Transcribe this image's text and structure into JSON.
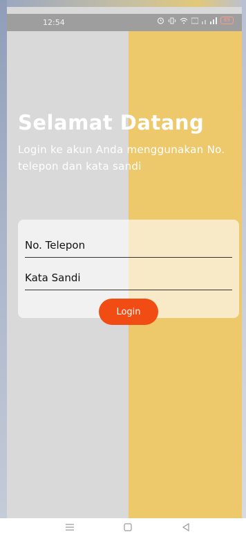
{
  "status_bar": {
    "time": "12:54",
    "battery_level": "69"
  },
  "welcome": {
    "title": "Selamat Datang",
    "subtitle": "Login ke akun Anda menggunakan No. telepon dan kata sandi"
  },
  "form": {
    "phone_placeholder": "No. Telepon",
    "password_placeholder": "Kata Sandi",
    "login_label": "Login"
  },
  "colors": {
    "left_panel": "#d9d9d9",
    "right_panel": "#edc96b",
    "login_button": "#f04c14"
  },
  "nav_icons": [
    "menu-icon",
    "home-icon",
    "back-icon"
  ]
}
